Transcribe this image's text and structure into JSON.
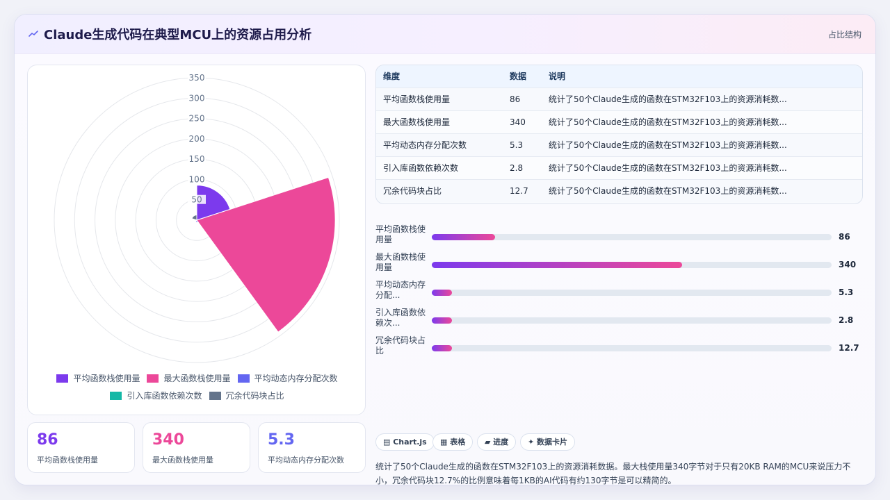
{
  "header": {
    "title": "Claude生成代码在典型MCU上的资源占用分析",
    "right_label": "占比结构"
  },
  "colors": {
    "series": [
      "#7c3aed",
      "#ec4899",
      "#6366f1",
      "#14b8a6",
      "#64748b"
    ],
    "stat_values": [
      "#7c3aed",
      "#ec4899",
      "#6366f1"
    ]
  },
  "chart_data": {
    "type": "polarArea",
    "categories": [
      "平均函数栈使用量",
      "最大函数栈使用量",
      "平均动态内存分配次数",
      "引入库函数依赖次数",
      "冗余代码块占比"
    ],
    "values": [
      86,
      340,
      5.3,
      2.8,
      12.7
    ],
    "r_ticks": [
      50,
      100,
      150,
      200,
      250,
      300,
      350
    ],
    "r_max": 350,
    "legend_position": "bottom",
    "grid": true
  },
  "stats": [
    {
      "value": "86",
      "label": "平均函数栈使用量"
    },
    {
      "value": "340",
      "label": "最大函数栈使用量"
    },
    {
      "value": "5.3",
      "label": "平均动态内存分配次数"
    }
  ],
  "table": {
    "headers": [
      "维度",
      "数据",
      "说明"
    ],
    "rows": [
      [
        "平均函数栈使用量",
        "86",
        "统计了50个Claude生成的函数在STM32F103上的资源消耗数..."
      ],
      [
        "最大函数栈使用量",
        "340",
        "统计了50个Claude生成的函数在STM32F103上的资源消耗数..."
      ],
      [
        "平均动态内存分配次数",
        "5.3",
        "统计了50个Claude生成的函数在STM32F103上的资源消耗数..."
      ],
      [
        "引入库函数依赖次数",
        "2.8",
        "统计了50个Claude生成的函数在STM32F103上的资源消耗数..."
      ],
      [
        "冗余代码块占比",
        "12.7",
        "统计了50个Claude生成的函数在STM32F103上的资源消耗数..."
      ]
    ]
  },
  "bars": {
    "max": 340,
    "items": [
      {
        "label": "平均函数栈使\n用量",
        "value": 86,
        "display": "86"
      },
      {
        "label": "最大函数栈使\n用量",
        "value": 340,
        "display": "340"
      },
      {
        "label": "平均动态内存\n分配...",
        "value": 5.3,
        "display": "5.3"
      },
      {
        "label": "引入库函数依\n赖次...",
        "value": 2.8,
        "display": "2.8"
      },
      {
        "label": "冗余代码块占\n比",
        "value": 12.7,
        "display": "12.7"
      }
    ]
  },
  "chips": [
    "▤ Chart.js",
    "▦ 表格",
    "▰ 进度",
    "✦ 数据卡片"
  ],
  "note": "统计了50个Claude生成的函数在STM32F103上的资源消耗数据。最大栈使用量340字节对于只有20KB RAM的MCU来说压力不小，冗余代码块12.7%的比例意味着每1KB的AI代码有约130字节是可以精简的。"
}
